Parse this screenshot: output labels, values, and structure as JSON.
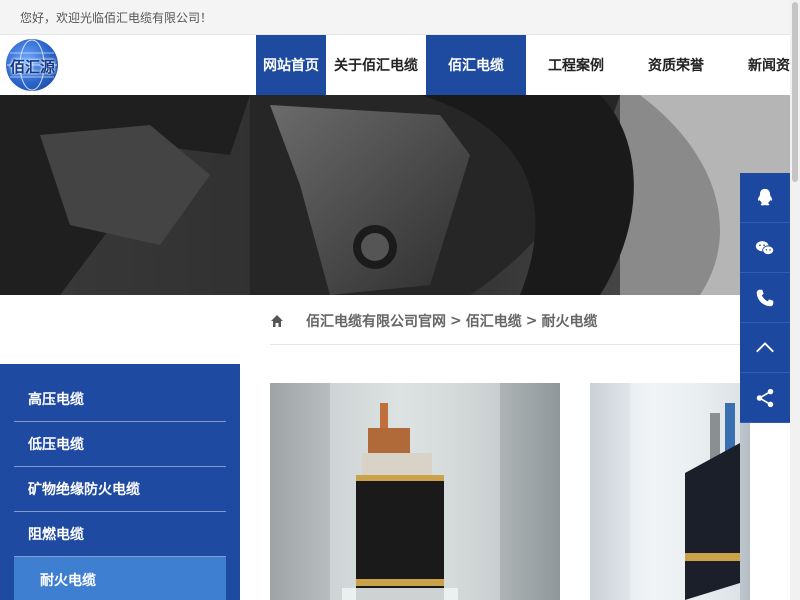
{
  "topbar": {
    "welcome": "您好，欢迎光临佰汇电缆有限公司！"
  },
  "logo": {
    "text": "佰汇源"
  },
  "nav": [
    {
      "label": "网站首页",
      "active": true
    },
    {
      "label": "关于佰汇电缆",
      "active": false
    },
    {
      "label": "佰汇电缆",
      "active": true
    },
    {
      "label": "工程案例",
      "active": false
    },
    {
      "label": "资质荣誉",
      "active": false
    },
    {
      "label": "新闻资",
      "active": false
    }
  ],
  "breadcrumb": {
    "home_icon": "home-icon",
    "items": [
      "佰汇电缆有限公司官网",
      "佰汇电缆",
      "耐火电缆"
    ],
    "separator": ">"
  },
  "sidebar": {
    "items": [
      {
        "label": "高压电缆",
        "active": false
      },
      {
        "label": "低压电缆",
        "active": false
      },
      {
        "label": "矿物绝缘防火电缆",
        "active": false
      },
      {
        "label": "阻燃电缆",
        "active": false
      },
      {
        "label": "耐火电缆",
        "active": true
      }
    ]
  },
  "float_bar": {
    "icons": [
      "qq-icon",
      "wechat-icon",
      "phone-icon",
      "back-to-top-icon",
      "share-icon"
    ]
  },
  "colors": {
    "primary": "#1e4aa0",
    "sidebar_active": "#3f7fd2"
  }
}
